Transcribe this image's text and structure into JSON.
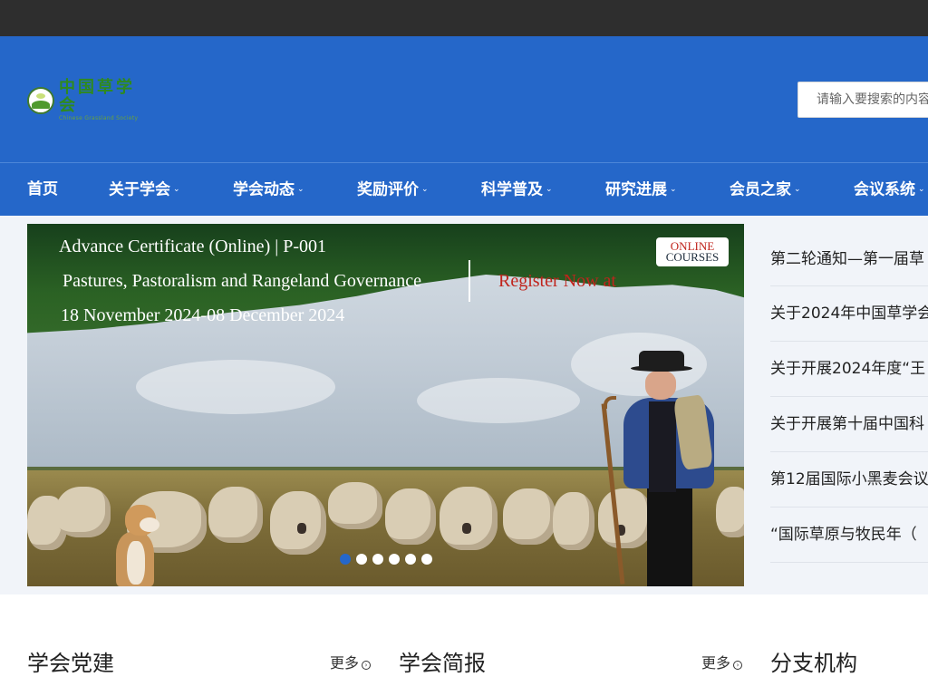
{
  "header": {
    "logo_cn": "中国草学会",
    "logo_en": "Chinese Grassland Society",
    "search_placeholder": "请输入要搜索的内容"
  },
  "nav": {
    "items": [
      {
        "label": "首页",
        "has_dropdown": false
      },
      {
        "label": "关于学会",
        "has_dropdown": true
      },
      {
        "label": "学会动态",
        "has_dropdown": true
      },
      {
        "label": "奖励评价",
        "has_dropdown": true
      },
      {
        "label": "科学普及",
        "has_dropdown": true
      },
      {
        "label": "研究进展",
        "has_dropdown": true
      },
      {
        "label": "会员之家",
        "has_dropdown": true
      },
      {
        "label": "会议系统",
        "has_dropdown": true
      }
    ],
    "caret": "⌄"
  },
  "banner": {
    "line1": "Advance Certificate (Online) | P-001",
    "line2": "Pastures, Pastoralism and Rangeland Governance",
    "line3": "18 November 2024-08 December 2024",
    "register": "Register Now at",
    "badge_line1": "ONLINE",
    "badge_line2": "COURSES",
    "dots": 6,
    "active_dot": 0
  },
  "news": {
    "items": [
      "第二轮通知—第一届草",
      "关于2024年中国草学会",
      "关于开展2024年度“王",
      "关于开展第十届中国科",
      "第12届国际小黑麦会议",
      "“国际草原与牧民年（"
    ]
  },
  "sections": [
    {
      "title": "学会党建",
      "more": "更多"
    },
    {
      "title": "学会简报",
      "more": "更多"
    },
    {
      "title": "分支机构"
    }
  ],
  "colors": {
    "primary": "#2567c9",
    "topbar": "#2e2e2e",
    "register": "#c0241c"
  }
}
